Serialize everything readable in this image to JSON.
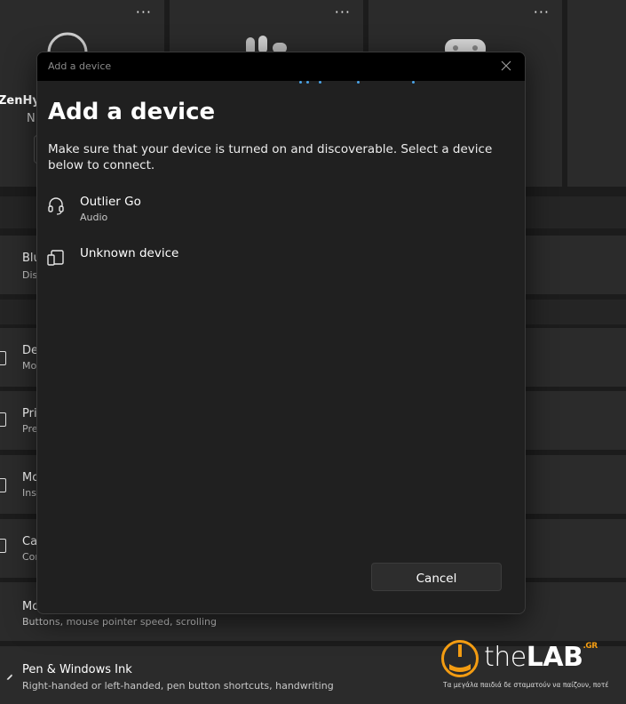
{
  "background": {
    "cards": [
      {
        "more_label": "···",
        "device_name": "ZenHyb",
        "device_status": "N"
      },
      {
        "more_label": "···"
      },
      {
        "more_label": "···"
      }
    ],
    "rows": [
      {
        "title": "Blu",
        "subtitle": "Dis"
      },
      {
        "title": "De",
        "subtitle": "Mo"
      },
      {
        "title": "Pri",
        "subtitle": "Pre"
      },
      {
        "title": "Mo",
        "subtitle": "Inst"
      },
      {
        "title": "Ca",
        "subtitle": "Cor"
      },
      {
        "title": "Mo",
        "subtitle": "Buttons, mouse pointer speed, scrolling"
      },
      {
        "title": "Pen & Windows Ink",
        "subtitle": "Right-handed or left-handed, pen button shortcuts, handwriting"
      }
    ]
  },
  "dialog": {
    "window_title": "Add a device",
    "heading": "Add a device",
    "description": "Make sure that your device is turned on and discoverable. Select a device below to connect.",
    "devices": [
      {
        "name": "Outlier Go",
        "type": "Audio",
        "icon": "headset-icon"
      },
      {
        "name": "Unknown device",
        "type": "",
        "icon": "unknown-device-icon"
      }
    ],
    "cancel_label": "Cancel",
    "accent_color": "#4aa3e6"
  },
  "watermark": {
    "brand_prefix": "the",
    "brand_main": "LAB",
    "brand_suffix": ".GR",
    "tagline": "Τα μεγάλα παιδιά δε σταματούν να παίζουν, ποτέ"
  }
}
